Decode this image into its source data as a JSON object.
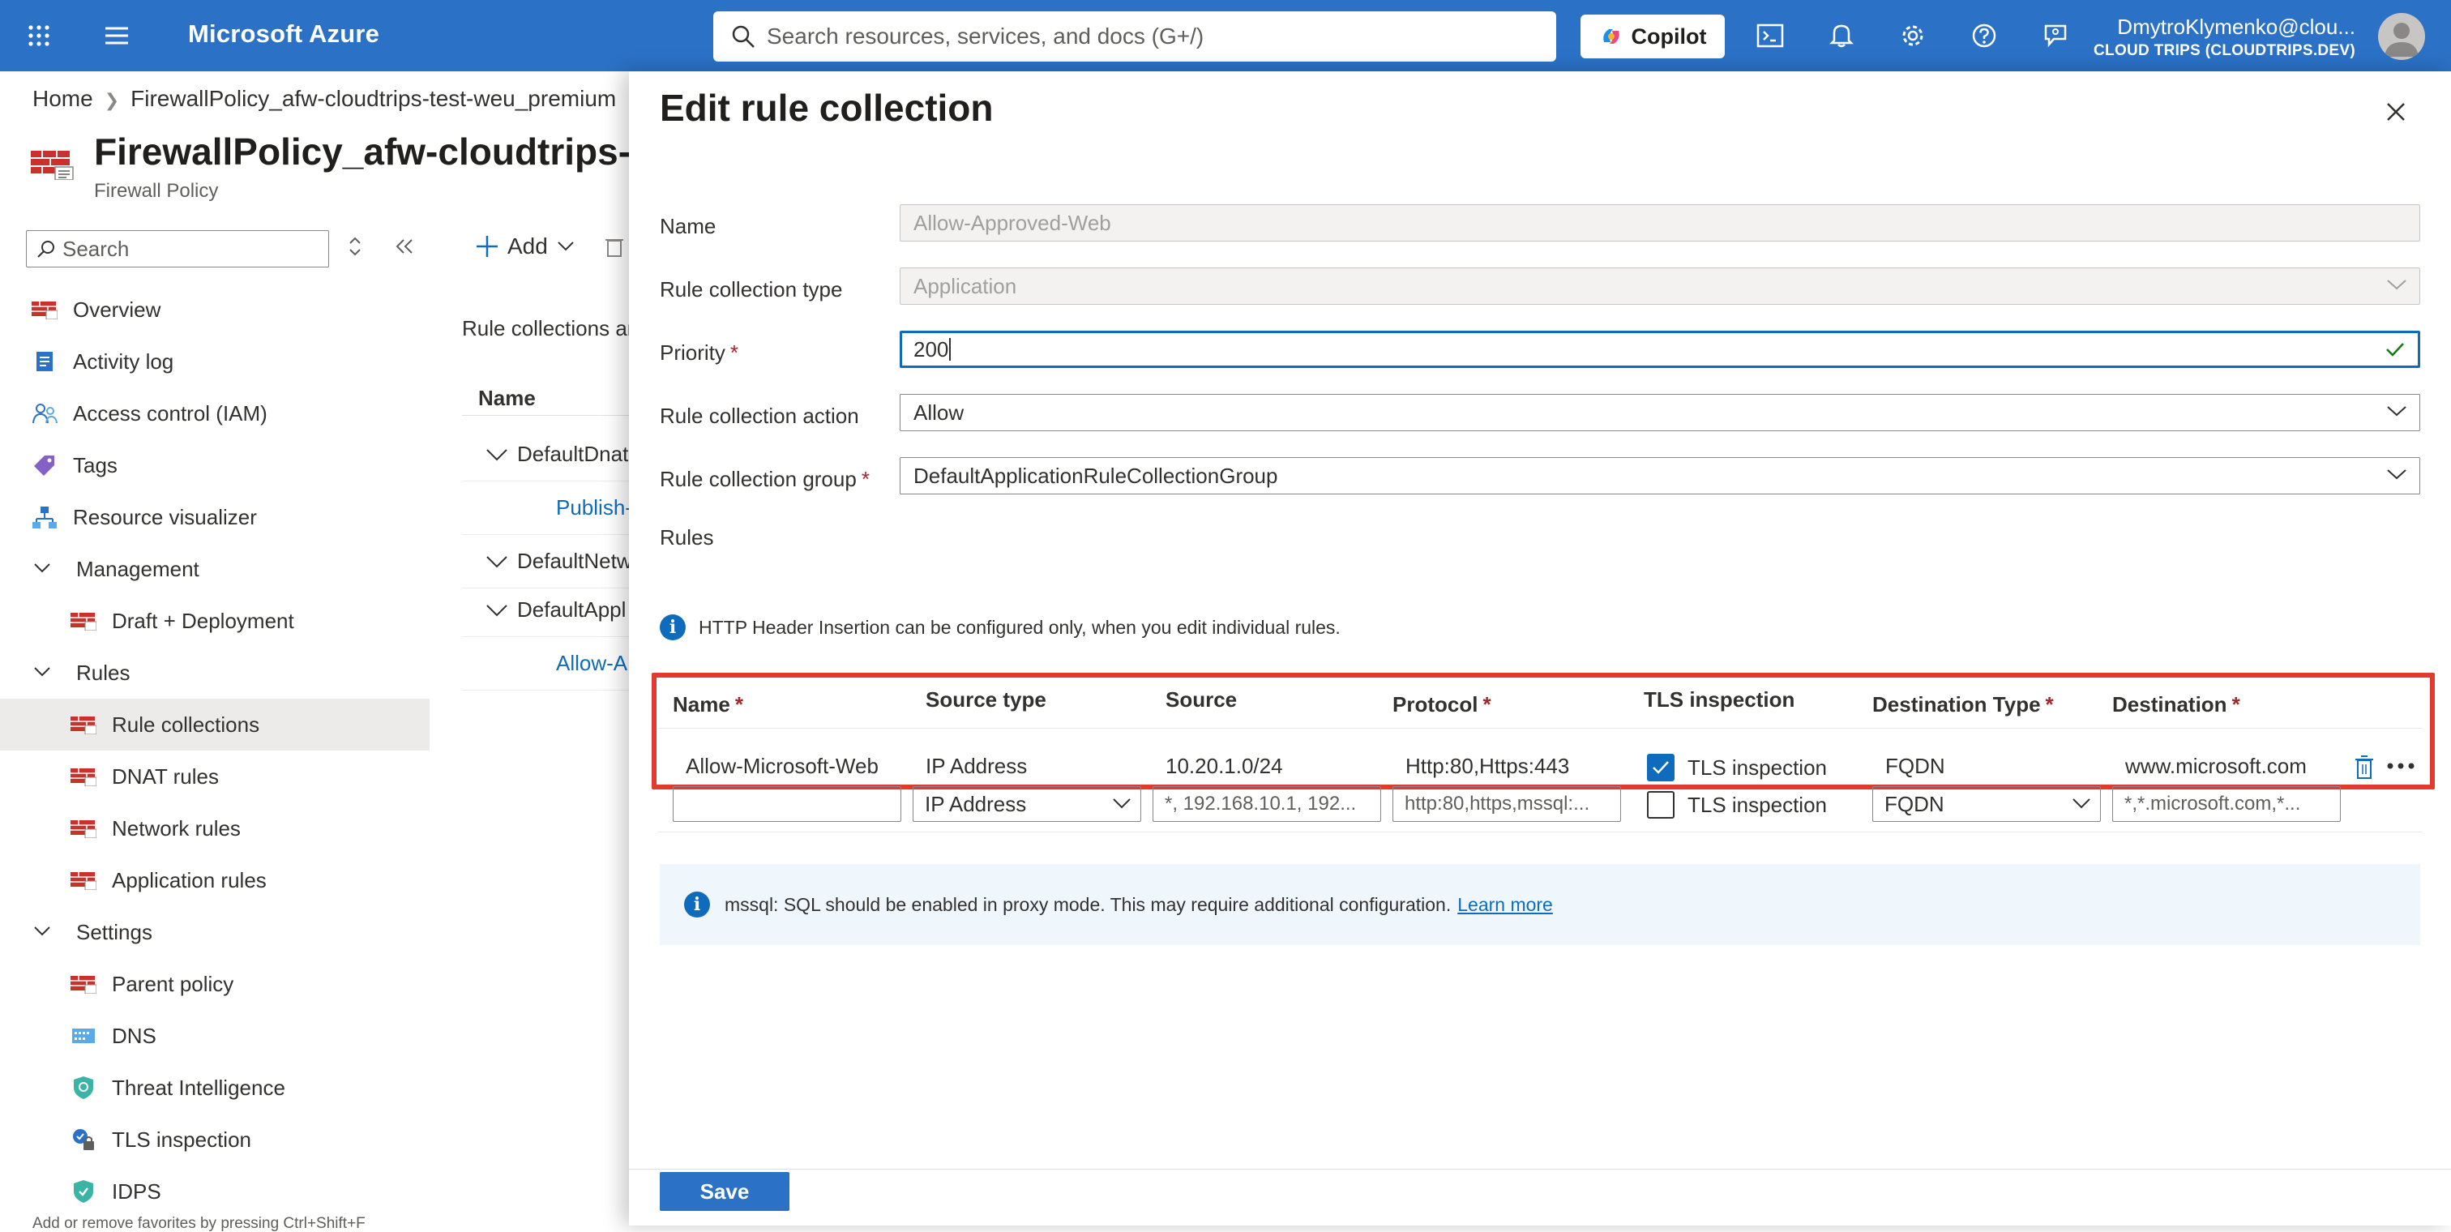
{
  "topbar": {
    "brand": "Microsoft Azure",
    "search_placeholder": "Search resources, services, and docs (G+/)",
    "copilot_label": "Copilot",
    "user_name": "DmytroKlymenko@clou...",
    "user_directory": "CLOUD TRIPS (CLOUDTRIPS.DEV)"
  },
  "breadcrumb": {
    "home": "Home",
    "resource": "FirewallPolicy_afw-cloudtrips-test-weu_premium"
  },
  "resource": {
    "title": "FirewallPolicy_afw-cloudtrips-",
    "subtitle": "Firewall Policy"
  },
  "nav": {
    "search_placeholder": "Search",
    "overview": "Overview",
    "activity_log": "Activity log",
    "access_control": "Access control (IAM)",
    "tags": "Tags",
    "resource_visualizer": "Resource visualizer",
    "management": "Management",
    "draft_deployment": "Draft + Deployment",
    "rules": "Rules",
    "rule_collections": "Rule collections",
    "dnat_rules": "DNAT rules",
    "network_rules": "Network rules",
    "application_rules": "Application rules",
    "settings": "Settings",
    "parent_policy": "Parent policy",
    "dns": "DNS",
    "threat_intelligence": "Threat Intelligence",
    "tls_inspection": "TLS inspection",
    "idps": "IDPS",
    "favorites_hint": "Add or remove favorites by pressing Ctrl+Shift+F"
  },
  "middle": {
    "add_label": "Add",
    "description": "Rule collections ar",
    "name_header": "Name",
    "rows": [
      "DefaultDnat",
      "Publish-",
      "DefaultNetw",
      "DefaultAppl",
      "Allow-A"
    ]
  },
  "panel": {
    "title": "Edit rule collection",
    "name_label": "Name",
    "name_value": "Allow-Approved-Web",
    "type_label": "Rule collection type",
    "type_value": "Application",
    "priority_label": "Priority",
    "priority_value": "200",
    "action_label": "Rule collection action",
    "action_value": "Allow",
    "group_label": "Rule collection group",
    "group_value": "DefaultApplicationRuleCollectionGroup",
    "rules_label": "Rules",
    "required_mark": "*",
    "info_header_insertion": "HTTP Header Insertion can be configured only, when you edit individual rules.",
    "save_label": "Save"
  },
  "rules_grid": {
    "headers": {
      "name": "Name",
      "source_type": "Source type",
      "source": "Source",
      "protocol": "Protocol",
      "tls": "TLS inspection",
      "dest_type": "Destination Type",
      "destination": "Destination"
    },
    "row": {
      "name": "Allow-Microsoft-Web",
      "source_type": "IP Address",
      "source": "10.20.1.0/24",
      "protocol": "Http:80,Https:443",
      "tls_label": "TLS inspection",
      "tls_checked": true,
      "dest_type": "FQDN",
      "destination": "www.microsoft.com"
    },
    "new_row": {
      "source_type": "IP Address",
      "source_placeholder": "*, 192.168.10.1, 192...",
      "protocol_placeholder": "http:80,https,mssql:...",
      "tls_label": "TLS inspection",
      "dest_type": "FQDN",
      "destination_placeholder": "*,*.microsoft.com,*..."
    }
  },
  "mssql_info": {
    "text": "mssql: SQL should be enabled in proxy mode. This may require additional configuration.",
    "link": "Learn more"
  },
  "colors": {
    "azure_blue": "#2b71c6",
    "highlight_red": "#e23a2e",
    "link_blue": "#0f6cbd",
    "required_red": "#a4262c"
  }
}
